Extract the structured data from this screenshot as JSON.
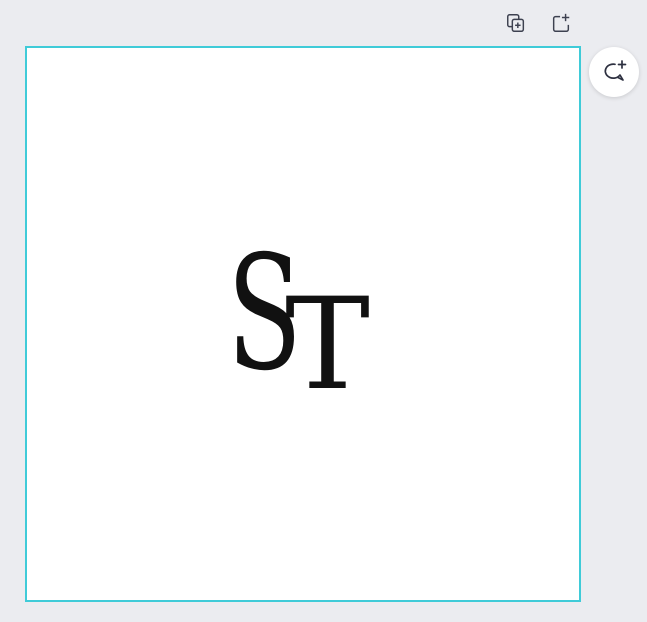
{
  "toolbar": {
    "duplicate_icon": "duplicate-page-icon",
    "add_page_icon": "add-page-icon"
  },
  "canvas": {
    "border_color": "#3fcbd8",
    "monogram": {
      "letter_1": "S",
      "letter_2": "T"
    }
  },
  "comment": {
    "icon": "add-comment-icon"
  }
}
